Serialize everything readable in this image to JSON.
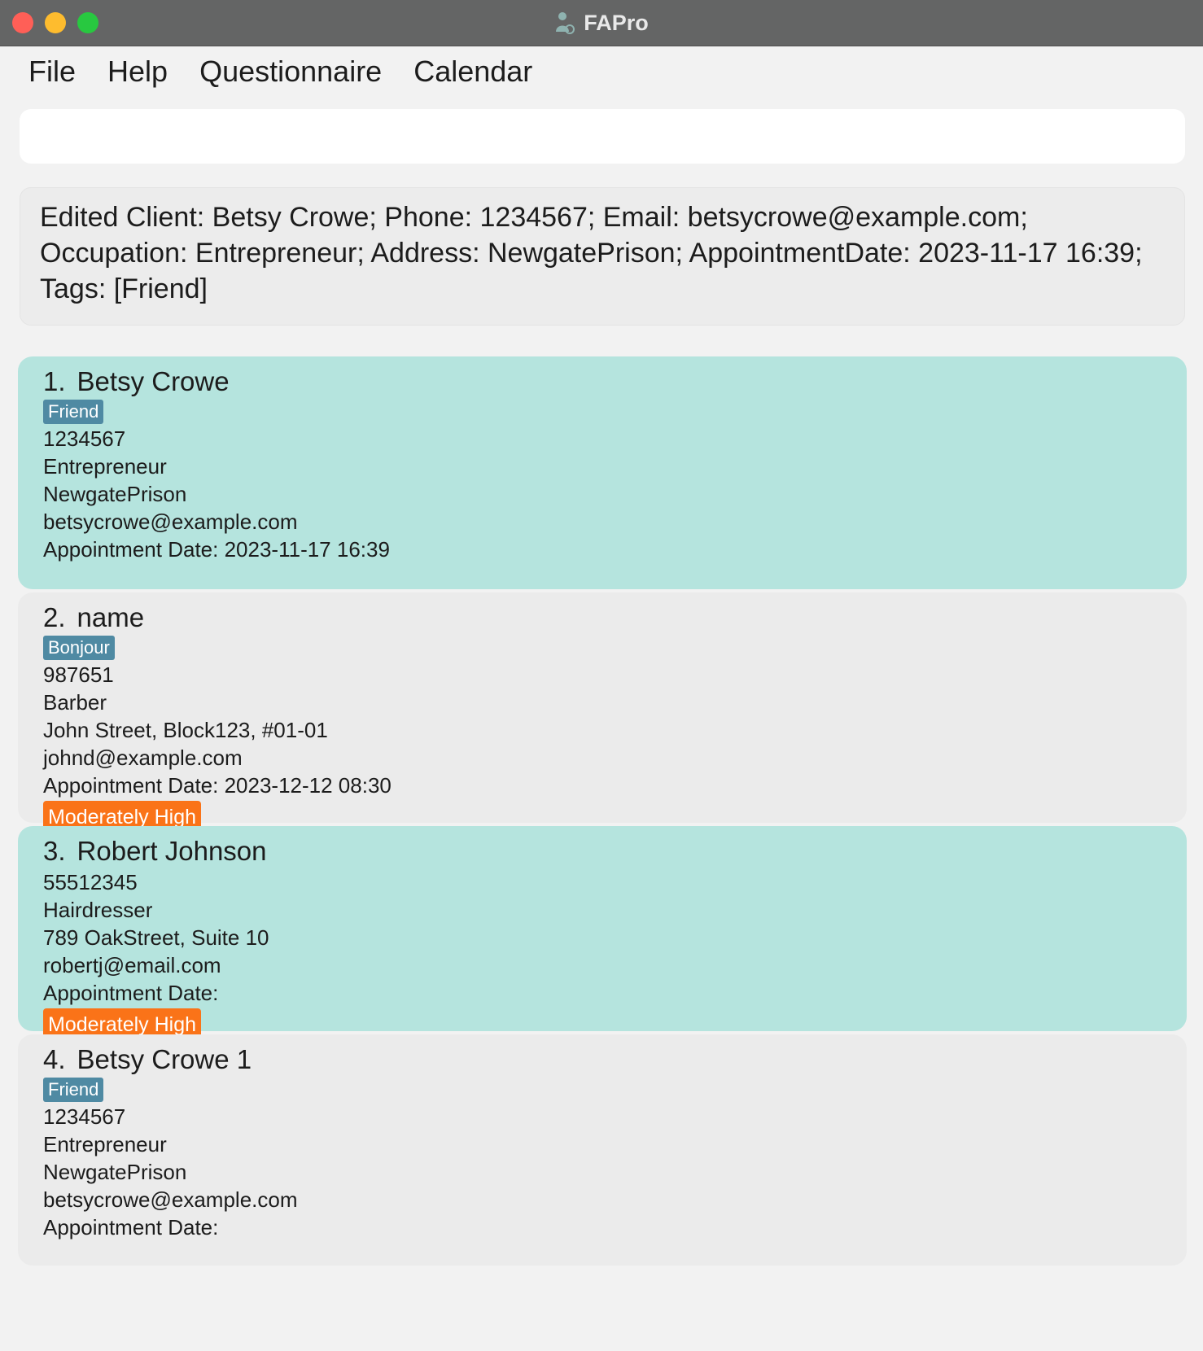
{
  "window": {
    "title": "FAPro",
    "colors": {
      "titlebar": "#646565",
      "close": "#ff5f57",
      "minimize": "#febc2e",
      "maximize": "#28c840"
    }
  },
  "menu": {
    "items": [
      "File",
      "Help",
      "Questionnaire",
      "Calendar"
    ]
  },
  "command": {
    "value": "",
    "placeholder": ""
  },
  "result": {
    "text": "Edited Client: Betsy Crowe; Phone: 1234567; Email: betsycrowe@example.com; Occupation: Entrepreneur; Address: NewgatePrison; AppointmentDate: 2023-11-17 16:39; Tags: [Friend]"
  },
  "colors": {
    "card_odd": "#b5e4de",
    "card_even": "#ebebeb",
    "tag": "#4f8aa3",
    "risk": "#fa7318"
  },
  "clients": [
    {
      "index": "1.",
      "name": "Betsy Crowe",
      "tags": [
        "Friend"
      ],
      "phone": "1234567",
      "occupation": "Entrepreneur",
      "address": "NewgatePrison",
      "email": "betsycrowe@example.com",
      "appointment": "Appointment Date: 2023-11-17 16:39",
      "risk": ""
    },
    {
      "index": "2.",
      "name": "name",
      "tags": [
        "Bonjour"
      ],
      "phone": "987651",
      "occupation": "Barber",
      "address": "John Street, Block123, #01-01",
      "email": "johnd@example.com",
      "appointment": "Appointment Date: 2023-12-12 08:30",
      "risk": "Moderately High"
    },
    {
      "index": "3.",
      "name": "Robert Johnson",
      "tags": [],
      "phone": "55512345",
      "occupation": "Hairdresser",
      "address": "789 OakStreet, Suite 10",
      "email": "robertj@email.com",
      "appointment": "Appointment Date:",
      "risk": "Moderately High"
    },
    {
      "index": "4.",
      "name": "Betsy Crowe 1",
      "tags": [
        "Friend"
      ],
      "phone": "1234567",
      "occupation": "Entrepreneur",
      "address": "NewgatePrison",
      "email": "betsycrowe@example.com",
      "appointment": "Appointment Date:",
      "risk": ""
    }
  ]
}
